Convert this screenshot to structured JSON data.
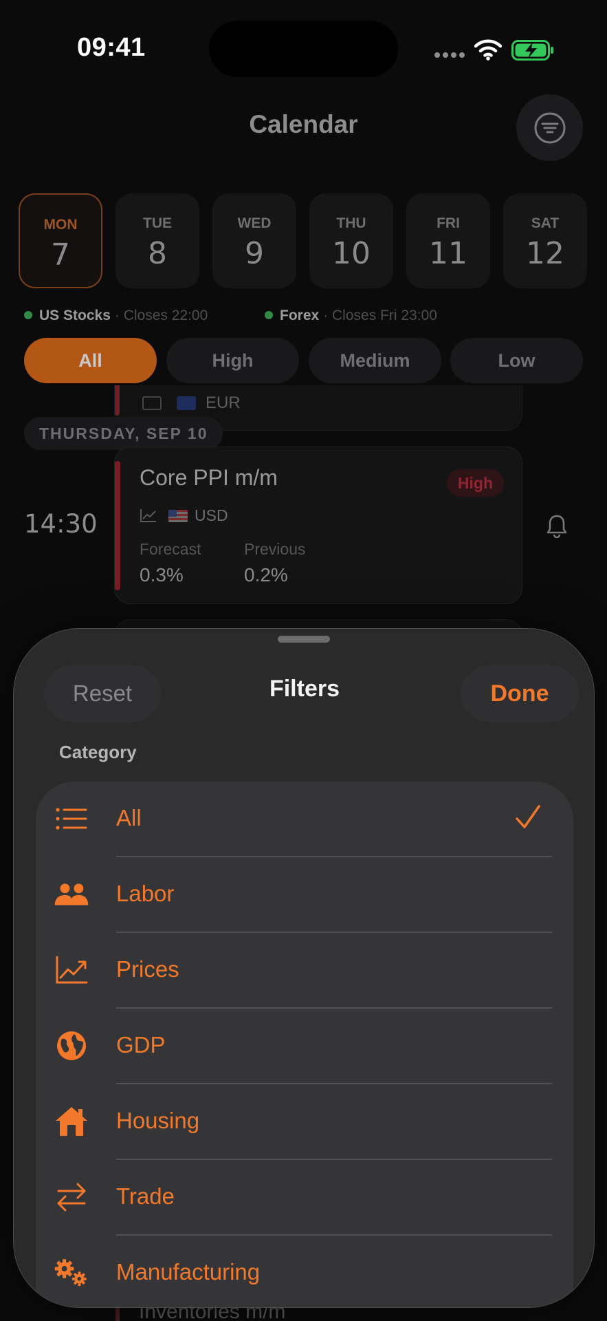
{
  "status_bar": {
    "time": "09:41"
  },
  "header": {
    "title": "Calendar"
  },
  "days": [
    {
      "name": "MON",
      "date": "7",
      "selected": true
    },
    {
      "name": "TUE",
      "date": "8",
      "selected": false
    },
    {
      "name": "WED",
      "date": "9",
      "selected": false
    },
    {
      "name": "THU",
      "date": "10",
      "selected": false
    },
    {
      "name": "FRI",
      "date": "11",
      "selected": false
    },
    {
      "name": "SAT",
      "date": "12",
      "selected": false
    }
  ],
  "markets": [
    {
      "name": "US Stocks",
      "status": "· Closes 22:00"
    },
    {
      "name": "Forex",
      "status": "· Closes Fri 23:00"
    }
  ],
  "impact_chips": [
    {
      "label": "All",
      "selected": true
    },
    {
      "label": "High",
      "selected": false
    },
    {
      "label": "Medium",
      "selected": false
    },
    {
      "label": "Low",
      "selected": false
    }
  ],
  "previous_event": {
    "currency": "EUR"
  },
  "date_header": "THURSDAY, SEP 10",
  "event": {
    "time": "14:30",
    "name": "Core PPI m/m",
    "impact": "High",
    "currency": "USD",
    "forecast_label": "Forecast",
    "forecast_value": "0.3%",
    "previous_label": "Previous",
    "previous_value": "0.2%"
  },
  "peek_event": {
    "name": "Inventories m/m"
  },
  "sheet": {
    "reset_label": "Reset",
    "title": "Filters",
    "done_label": "Done",
    "section_label": "Category",
    "categories": [
      {
        "label": "All",
        "icon": "list-icon",
        "checked": true
      },
      {
        "label": "Labor",
        "icon": "people-icon",
        "checked": false
      },
      {
        "label": "Prices",
        "icon": "chart-line-icon",
        "checked": false
      },
      {
        "label": "GDP",
        "icon": "globe-icon",
        "checked": false
      },
      {
        "label": "Housing",
        "icon": "house-icon",
        "checked": false
      },
      {
        "label": "Trade",
        "icon": "arrows-swap-icon",
        "checked": false
      },
      {
        "label": "Manufacturing",
        "icon": "gears-icon",
        "checked": false
      }
    ]
  },
  "colors": {
    "accent": "#f2792b",
    "high_impact": "#8e2631",
    "sheet_bg": "#2a2a2b",
    "list_bg": "#353537"
  }
}
